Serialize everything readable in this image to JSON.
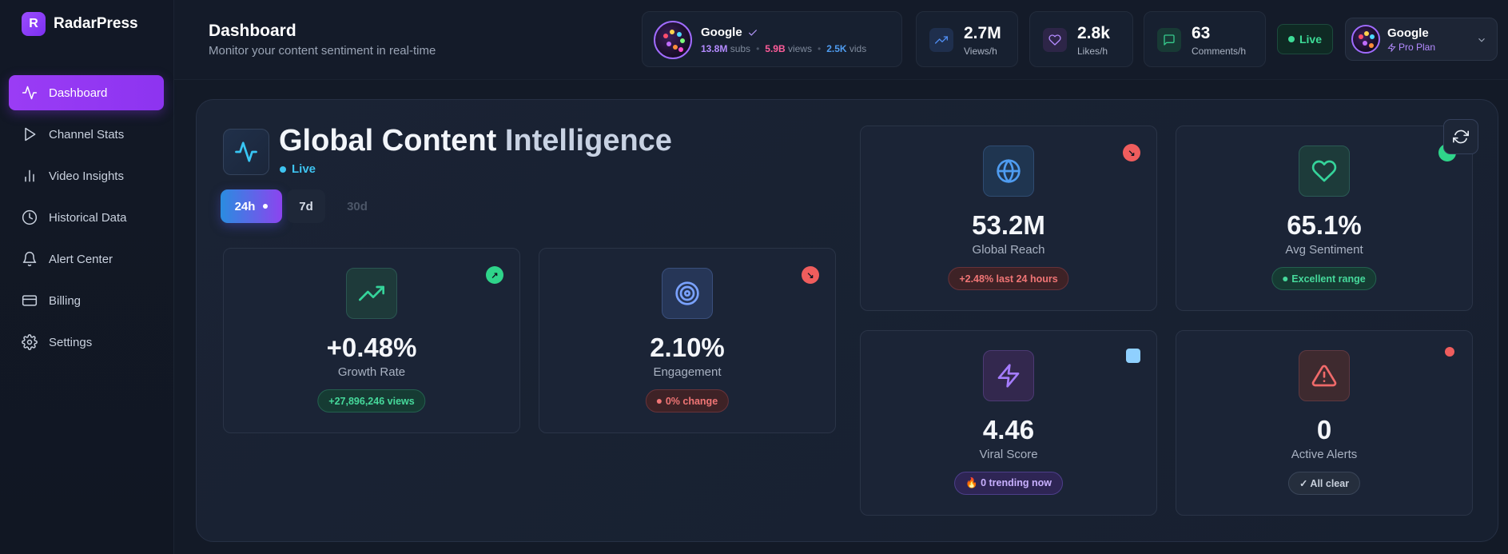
{
  "brand": {
    "logo_letter": "R",
    "name": "RadarPress"
  },
  "sidebar": {
    "items": [
      {
        "label": "Dashboard",
        "icon": "activity-icon",
        "active": true
      },
      {
        "label": "Channel Stats",
        "icon": "play-icon"
      },
      {
        "label": "Video Insights",
        "icon": "bar-chart-icon"
      },
      {
        "label": "Historical Data",
        "icon": "clock-icon"
      },
      {
        "label": "Alert Center",
        "icon": "bell-icon"
      },
      {
        "label": "Billing",
        "icon": "credit-card-icon"
      },
      {
        "label": "Settings",
        "icon": "gear-icon"
      }
    ]
  },
  "header": {
    "title": "Dashboard",
    "subtitle": "Monitor your content sentiment in real-time",
    "channel": {
      "name": "Google",
      "subs_value": "13.8M",
      "subs_label": "subs",
      "views_value": "5.9B",
      "views_label": "views",
      "vids_value": "2.5K",
      "vids_label": "vids"
    },
    "metrics": [
      {
        "value": "2.7M",
        "label": "Views/h",
        "icon": "trending-up-icon",
        "color": "#4f8cf0"
      },
      {
        "value": "2.8k",
        "label": "Likes/h",
        "icon": "heart-icon",
        "color": "#b48bff"
      },
      {
        "value": "63",
        "label": "Comments/h",
        "icon": "message-icon",
        "color": "#36c98c"
      }
    ],
    "live_label": "Live",
    "user": {
      "name": "Google",
      "plan": "Pro Plan"
    }
  },
  "panel": {
    "title_main": "Global Content",
    "title_accent": "Intelligence",
    "live_label": "Live",
    "tabs": [
      {
        "label": "24h",
        "active": true
      },
      {
        "label": "7d"
      },
      {
        "label": "30d",
        "disabled": true
      }
    ],
    "cards": {
      "growth": {
        "value": "+0.48%",
        "label": "Growth Rate",
        "badge": "+27,896,246 views",
        "corner": "↗"
      },
      "engagement": {
        "value": "2.10%",
        "label": "Engagement",
        "badge": "0% change",
        "corner": "↘"
      },
      "reach": {
        "value": "53.2M",
        "label": "Global Reach",
        "badge": "+2.48% last 24 hours",
        "corner": "↘"
      },
      "sentiment": {
        "value": "65.1%",
        "label": "Avg Sentiment",
        "badge": "Excellent range"
      },
      "viral": {
        "value": "4.46",
        "label": "Viral Score",
        "badge": "🔥 0 trending now"
      },
      "alerts": {
        "value": "0",
        "label": "Active Alerts",
        "badge": "✓ All clear"
      }
    }
  },
  "colors": {
    "accent": "#9a3cf5",
    "live": "#3ddc97",
    "cyan": "#38c6f4"
  }
}
